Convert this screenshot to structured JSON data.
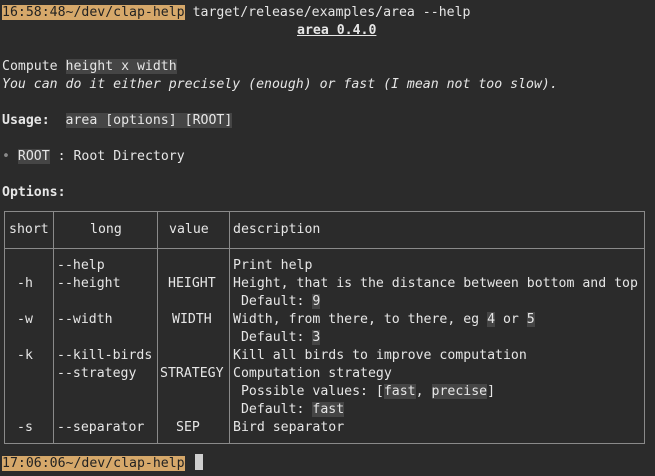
{
  "prompt1": {
    "time": "16:58:48",
    "path": "~/dev/clap-help",
    "command": " target/release/examples/area --help"
  },
  "app_title": "area 0.4.0",
  "about": {
    "line1_pre": "Compute ",
    "line1_hl": "height x width",
    "line2": "You can do it either precisely (enough) or fast (I mean not too slow)."
  },
  "usage": {
    "label": "Usage:",
    "value": "area [options] [ROOT]"
  },
  "arg": {
    "bullet": "•",
    "name": "ROOT",
    "desc": " : Root Directory"
  },
  "options_label": "Options:",
  "table": {
    "headers": {
      "short": "short",
      "long": "long",
      "value": "value",
      "description": "description"
    },
    "rows": [
      {
        "short": "",
        "long": "--help",
        "value": "",
        "desc": "Print help"
      },
      {
        "short": "-h",
        "long": "--height",
        "value": "HEIGHT",
        "desc": "Height, that is the distance between bottom and top"
      },
      {
        "short": "",
        "long": "",
        "value": "",
        "desc_pre": " Default: ",
        "desc_hl": "9"
      },
      {
        "short": "-w",
        "long": "--width",
        "value": "WIDTH",
        "desc_pre": "Width, from there, to there, eg ",
        "hl1": "4",
        "mid": " or ",
        "hl2": "5"
      },
      {
        "short": "",
        "long": "",
        "value": "",
        "desc_pre": " Default: ",
        "desc_hl": "3"
      },
      {
        "short": "-k",
        "long": "--kill-birds",
        "value": "",
        "desc": "Kill all birds to improve computation"
      },
      {
        "short": "",
        "long": "--strategy",
        "value": "STRATEGY",
        "desc": "Computation strategy"
      },
      {
        "short": "",
        "long": "",
        "value": "",
        "desc_pre": " Possible values: [",
        "hl1": "fast",
        "mid": ", ",
        "hl2": "precise",
        "post": "]"
      },
      {
        "short": "",
        "long": "",
        "value": "",
        "desc_pre": " Default: ",
        "desc_hl": "fast"
      },
      {
        "short": "-s",
        "long": "--separator",
        "value": "SEP",
        "desc": "Bird separator"
      }
    ]
  },
  "prompt2": {
    "time": "17:06:06",
    "path": "~/dev/clap-help"
  },
  "colors": {
    "background": "#2b2b2b",
    "prompt_bg": "#d6a86a",
    "highlight": "#454545",
    "border": "#8a8a8a"
  }
}
